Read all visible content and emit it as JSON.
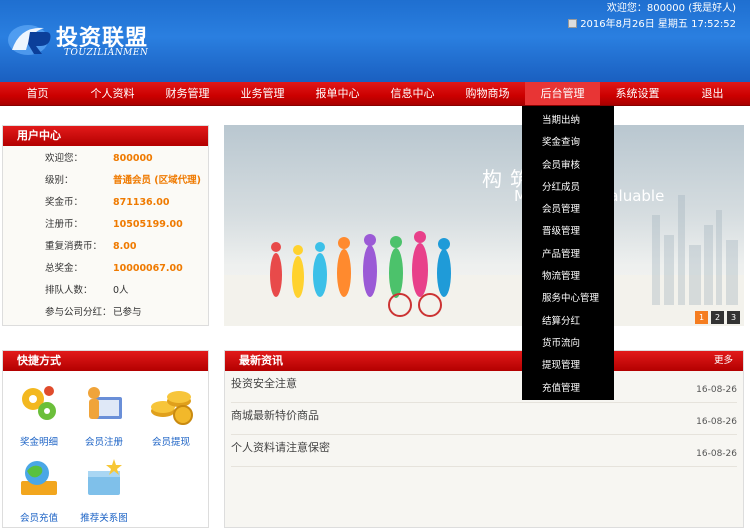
{
  "header": {
    "logo_text": "投资联盟",
    "logo_sub": "TOUZILIANMEN",
    "welcome": "欢迎您：800000 (我是好人)",
    "datetime": "2016年8月26日 星期五 17:52:52"
  },
  "nav": [
    "首页",
    "个人资料",
    "财务管理",
    "业务管理",
    "报单中心",
    "信息中心",
    "购物商场",
    "后台管理",
    "系统设置",
    "退出"
  ],
  "nav_active": "后台管理",
  "dropdown": [
    "当期出纳",
    "奖金查询",
    "会员审核",
    "分红成员",
    "会员管理",
    "晋级管理",
    "产品管理",
    "物流管理",
    "服务中心管理",
    "结算分红",
    "货币流向",
    "提现管理",
    "充值管理"
  ],
  "user_center": {
    "title": "用户中心",
    "rows": [
      {
        "k": "欢迎您：",
        "v": "800000"
      },
      {
        "k": "级别：",
        "v": "普通会员 (区域代理)"
      },
      {
        "k": "奖金币：",
        "v": "871136.00"
      },
      {
        "k": "注册币：",
        "v": "10505199.00"
      },
      {
        "k": "重复消费币：",
        "v": "8.00"
      },
      {
        "k": "总奖金：",
        "v": "10000067.00"
      },
      {
        "k": "排队人数：",
        "v": "0人"
      },
      {
        "k": "参与公司分红：",
        "v": "已参与"
      }
    ]
  },
  "banner": {
    "cn": "构筑价值",
    "en": "Make More Valuable",
    "pages": [
      "1",
      "2",
      "3"
    ]
  },
  "quick": {
    "title": "快捷方式",
    "items": [
      {
        "label": "奖金明细",
        "icon": "gears-icon"
      },
      {
        "label": "会员注册",
        "icon": "user-book-icon"
      },
      {
        "label": "会员提现",
        "icon": "coins-icon"
      },
      {
        "label": "会员充值",
        "icon": "globe-money-icon"
      },
      {
        "label": "推荐关系图",
        "icon": "box-star-icon"
      }
    ]
  },
  "news": {
    "title": "最新资讯",
    "more": "更多",
    "items": [
      {
        "title": "投资安全注意",
        "date": "16-08-26"
      },
      {
        "title": "商城最新特价商品",
        "date": "16-08-26"
      },
      {
        "title": "个人资料请注意保密",
        "date": "16-08-26"
      }
    ]
  },
  "colors": {
    "header_blue": "#1f6fd0",
    "nav_red": "#c00000",
    "accent_orange": "#ef7a00",
    "link_blue": "#1b62c5"
  }
}
